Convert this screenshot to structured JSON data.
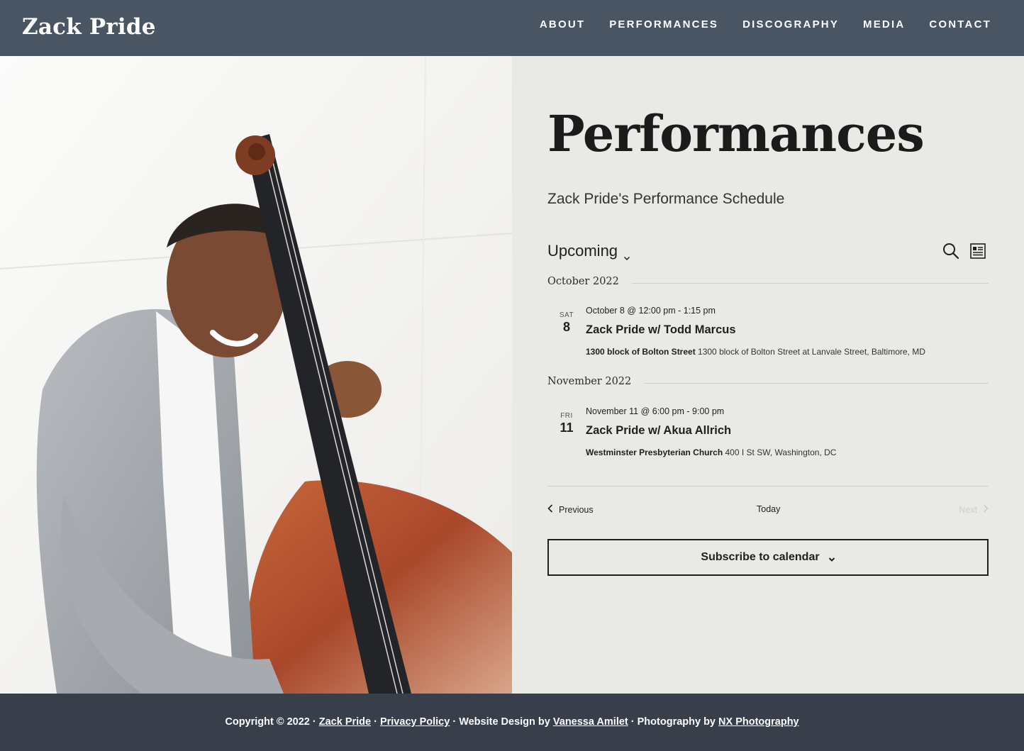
{
  "header": {
    "site_title": "Zack Pride",
    "nav": [
      "ABOUT",
      "PERFORMANCES",
      "DISCOGRAPHY",
      "MEDIA",
      "CONTACT"
    ]
  },
  "main": {
    "title": "Performances",
    "subtitle": "Zack Pride's Performance Schedule",
    "view_selector": "Upcoming",
    "months": [
      {
        "label": "October 2022",
        "events": [
          {
            "dow": "SAT",
            "day": "8",
            "time": "October 8 @ 12:00 pm - 1:15 pm",
            "title": "Zack Pride w/ Todd Marcus",
            "venue_name": "1300 block of Bolton Street",
            "venue_address": " 1300 block of Bolton Street at Lanvale Street, Baltimore, MD"
          }
        ]
      },
      {
        "label": "November 2022",
        "events": [
          {
            "dow": "FRI",
            "day": "11",
            "time": "November 11 @ 6:00 pm - 9:00 pm",
            "title": "Zack Pride w/ Akua Allrich",
            "venue_name": "Westminster Presbyterian Church",
            "venue_address": " 400 I St SW, Washington, DC"
          }
        ]
      }
    ],
    "pager": {
      "previous": "Previous",
      "today": "Today",
      "next": "Next"
    },
    "subscribe_label": "Subscribe to calendar"
  },
  "footer": {
    "copyright": "Copyright © 2022 · ",
    "site_link": "Zack Pride",
    "sep1": " · ",
    "privacy_link": "Privacy Policy",
    "design_prefix": " · Website Design by ",
    "design_link": "Vanessa Amilet",
    "photo_prefix": " · Photography by ",
    "photo_link": "NX Photography"
  },
  "colors": {
    "header_bg": "#4a5563",
    "footer_bg": "#383f4a",
    "content_bg": "#e9e9e5"
  },
  "icons": {
    "search": "search-icon",
    "list_view": "list-view-icon",
    "view_chevron": "chevron-down-icon"
  }
}
